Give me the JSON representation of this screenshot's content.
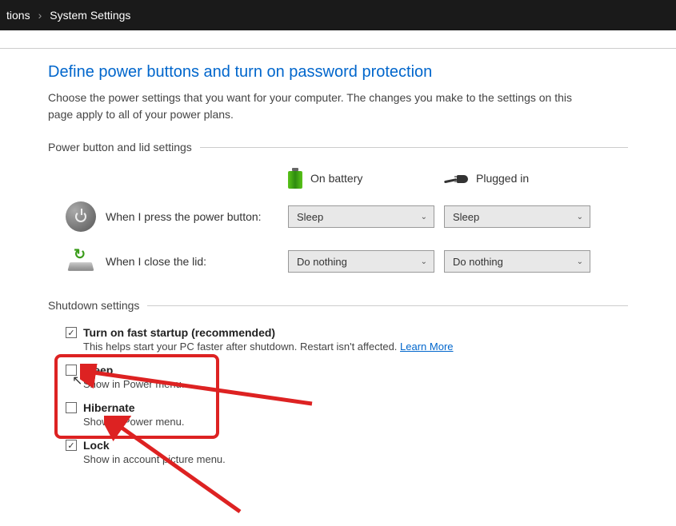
{
  "breadcrumb": {
    "item1": "tions",
    "item2": "System Settings"
  },
  "page": {
    "title": "Define power buttons and turn on password protection",
    "description": "Choose the power settings that you want for your computer. The changes you make to the settings on this page apply to all of your power plans."
  },
  "sections": {
    "power_lid": "Power button and lid settings",
    "shutdown": "Shutdown settings"
  },
  "columns": {
    "battery": "On battery",
    "plugged": "Plugged in"
  },
  "settings": {
    "power_button": {
      "label": "When I press the power button:",
      "battery_value": "Sleep",
      "plugged_value": "Sleep"
    },
    "lid": {
      "label": "When I close the lid:",
      "battery_value": "Do nothing",
      "plugged_value": "Do nothing"
    }
  },
  "shutdown": {
    "fast_startup": {
      "checked": true,
      "title": "Turn on fast startup (recommended)",
      "desc_prefix": "This helps start your PC faster after shutdown. Restart isn't affected. ",
      "learn_more": "Learn More"
    },
    "sleep": {
      "checked": false,
      "title": "Sleep",
      "desc": "Show in Power menu."
    },
    "hibernate": {
      "checked": false,
      "title": "Hibernate",
      "desc": "Show in Power menu."
    },
    "lock": {
      "checked": true,
      "title": "Lock",
      "desc": "Show in account picture menu."
    }
  }
}
